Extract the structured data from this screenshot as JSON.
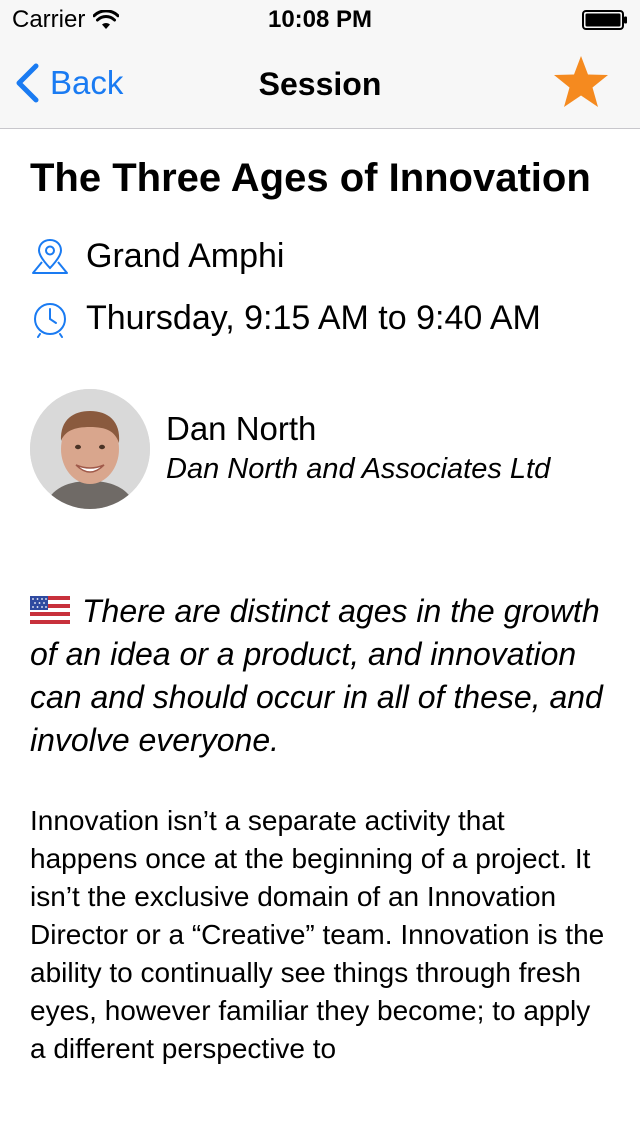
{
  "status_bar": {
    "carrier": "Carrier",
    "time": "10:08 PM",
    "icons": [
      "wifi-icon",
      "battery-icon"
    ]
  },
  "nav": {
    "back_label": "Back",
    "title": "Session",
    "favorite_icon": "star-icon",
    "accent_color": "#1a7bf2",
    "star_color": "#f58a1f"
  },
  "session": {
    "title": "The Three Ages of Innovation",
    "room": "Grand Amphi",
    "time": "Thursday, 9:15 AM to 9:40 AM",
    "icons": [
      "location-pin-icon",
      "clock-icon",
      "us-flag-icon"
    ]
  },
  "speaker": {
    "name": "Dan North",
    "company": "Dan North and Associates Ltd"
  },
  "summary": "There are distinct ages in the growth of an idea or a product, and innovation can and should occur in all of these, and involve everyone.",
  "description": "Innovation isn’t a separate activity that happens once at the beginning of a project. It isn’t the exclusive domain of an Innovation Director or a “Creative” team. Innovation is the ability to continually see things through fresh eyes, however familiar they become; to apply a different perspective to"
}
